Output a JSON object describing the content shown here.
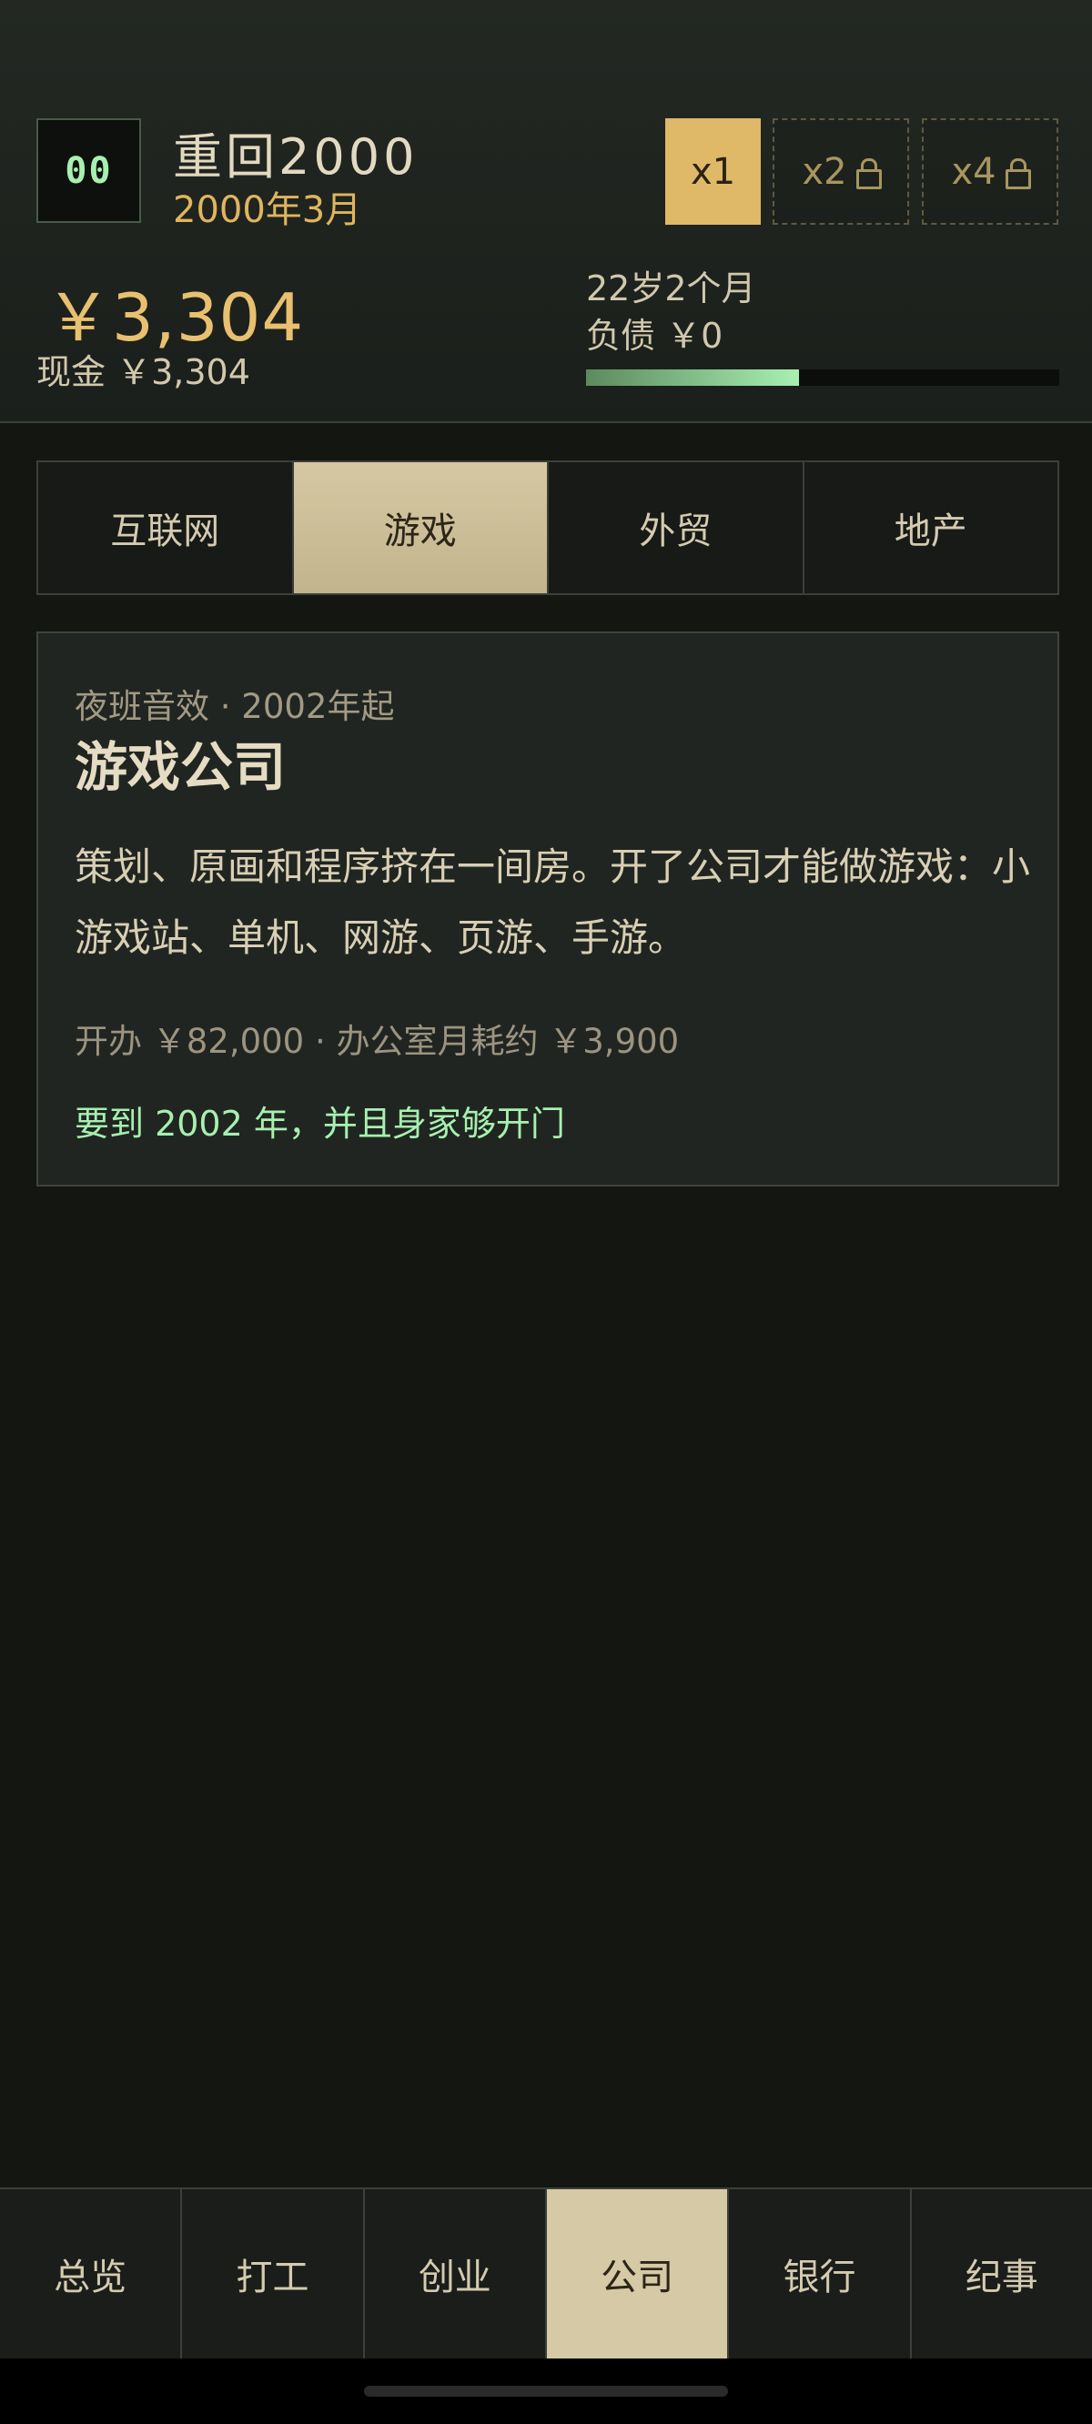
{
  "header": {
    "logo_text": "00",
    "title": "重回2000",
    "date": "2000年3月",
    "speed": [
      {
        "label": "x1",
        "locked": false,
        "active": true
      },
      {
        "label": "x2",
        "locked": true,
        "active": false
      },
      {
        "label": "x4",
        "locked": true,
        "active": false
      }
    ],
    "net_worth": "￥3,304",
    "cash": "现金 ￥3,304",
    "age": "22岁2个月",
    "debt": "负债 ￥0",
    "progress_fraction": 0.45
  },
  "tabs": [
    {
      "label": "互联网",
      "active": false
    },
    {
      "label": "游戏",
      "active": true
    },
    {
      "label": "外贸",
      "active": false
    },
    {
      "label": "地产",
      "active": false
    }
  ],
  "card": {
    "meta": "夜班音效 · 2002年起",
    "title": "游戏公司",
    "description": "策划、原画和程序挤在一间房。开了公司才能做游戏：小游戏站、单机、网游、页游、手游。",
    "cost": "开办 ￥82,000 · 办公室月耗约 ￥3,900",
    "hint": "要到 2002 年，并且身家够开门"
  },
  "bottom_nav": [
    {
      "label": "总览",
      "active": false
    },
    {
      "label": "打工",
      "active": false
    },
    {
      "label": "创业",
      "active": false
    },
    {
      "label": "公司",
      "active": true
    },
    {
      "label": "银行",
      "active": false
    },
    {
      "label": "纪事",
      "active": false
    }
  ],
  "colors": {
    "accent_gold": "#dfb868",
    "accent_green": "#a6f0b0",
    "background": "#141612"
  }
}
